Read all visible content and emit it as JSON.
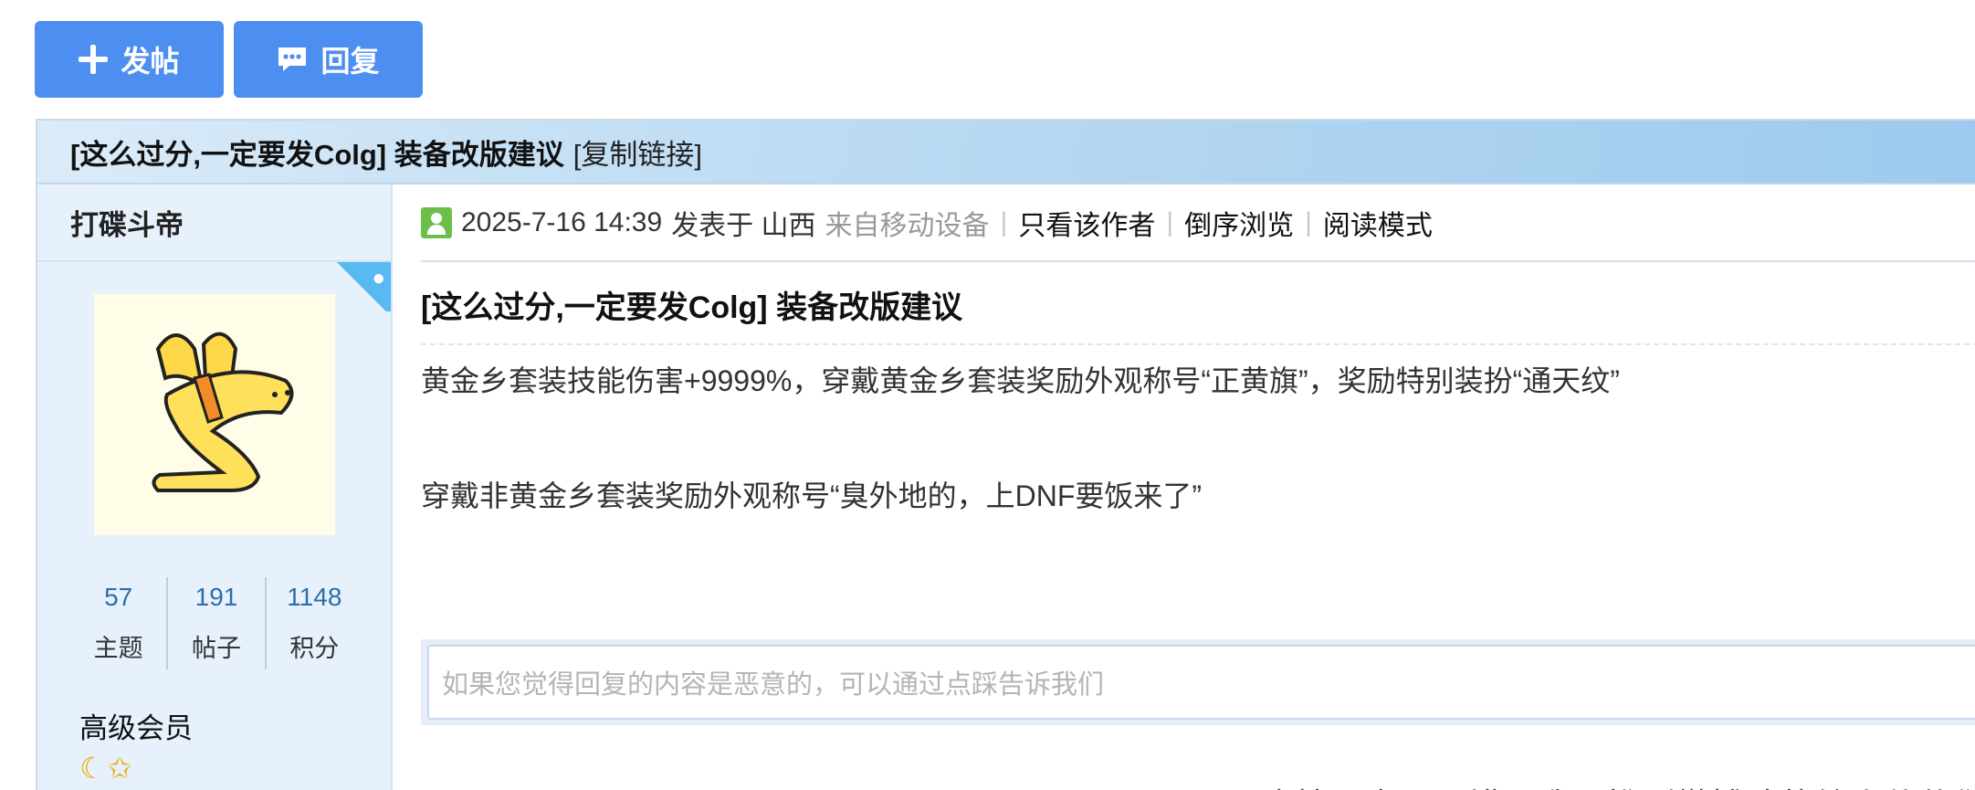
{
  "actions": {
    "post_label": "发帖",
    "reply_label": "回复"
  },
  "thread": {
    "title": "[这么过分,一定要发Colg] 装备改版建议",
    "copy_link": "[复制链接]"
  },
  "author": {
    "name": "打碟斗帝",
    "stats": [
      {
        "value": "57",
        "label": "主题"
      },
      {
        "value": "191",
        "label": "帖子"
      },
      {
        "value": "1148",
        "label": "积分"
      }
    ],
    "rank": "高级会员",
    "rank_icons": "☾✩"
  },
  "post": {
    "date": "2025-7-16 14:39",
    "posted_at": "发表于 山西",
    "device": "来自移动设备",
    "only_author": "只看该作者",
    "reverse": "倒序浏览",
    "read_mode": "阅读模式",
    "title": "[这么过分,一定要发Colg] 装备改版建议",
    "lines": [
      "黄金乡套装技能伤害+9999%，穿戴黄金乡套装奖励外观称号“正黄旗”，奖励特别装扮“通天纹”",
      "穿戴非黄金乡套装奖励外观称号“臭外地的，上DNF要饭来了”"
    ]
  },
  "report_placeholder": "如果您觉得回复的内容是恶意的，可以通过点踩告诉我们",
  "recommend_text": "这帖子真心不错。我要推到微博啥的给小伙伴们"
}
